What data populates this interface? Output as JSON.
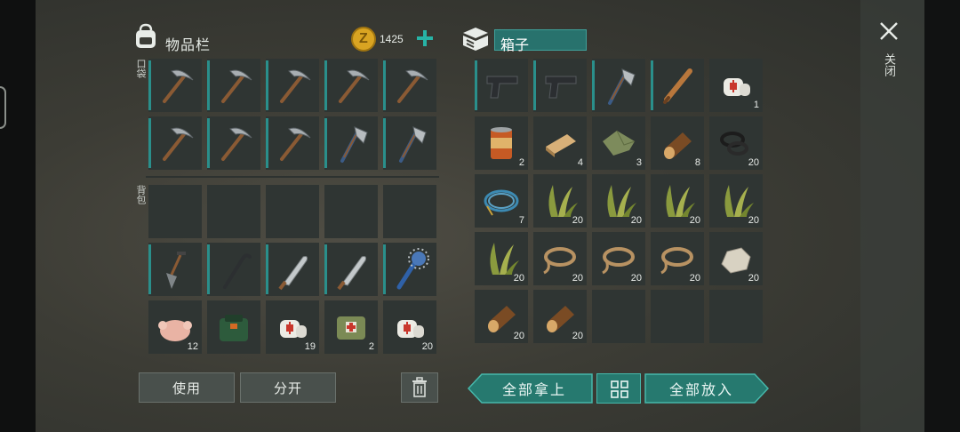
{
  "inventory": {
    "title": "物品栏",
    "coins": "1425",
    "pocket_label": "口袋",
    "backpack_label": "背包",
    "pocket_items": [
      {
        "name": "pickaxe",
        "qty": ""
      },
      {
        "name": "pickaxe",
        "qty": ""
      },
      {
        "name": "pickaxe",
        "qty": ""
      },
      {
        "name": "pickaxe",
        "qty": ""
      },
      {
        "name": "pickaxe",
        "qty": ""
      },
      {
        "name": "pickaxe",
        "qty": ""
      },
      {
        "name": "pickaxe",
        "qty": ""
      },
      {
        "name": "pickaxe",
        "qty": ""
      },
      {
        "name": "hatchet",
        "qty": ""
      },
      {
        "name": "hatchet",
        "qty": ""
      }
    ],
    "backpack_items": [
      {
        "name": "empty",
        "qty": ""
      },
      {
        "name": "empty",
        "qty": ""
      },
      {
        "name": "empty",
        "qty": ""
      },
      {
        "name": "empty",
        "qty": ""
      },
      {
        "name": "empty",
        "qty": ""
      },
      {
        "name": "shovel",
        "qty": ""
      },
      {
        "name": "crowbar",
        "qty": ""
      },
      {
        "name": "machete",
        "qty": ""
      },
      {
        "name": "machete",
        "qty": ""
      },
      {
        "name": "spiked-club",
        "qty": ""
      },
      {
        "name": "chicken",
        "qty": "12"
      },
      {
        "name": "backpack-bag",
        "qty": ""
      },
      {
        "name": "bandage",
        "qty": "19"
      },
      {
        "name": "first-aid-kit",
        "qty": "2"
      },
      {
        "name": "bandage",
        "qty": "20"
      }
    ],
    "use_button": "使用",
    "split_button": "分开"
  },
  "box": {
    "title": "箱子",
    "items": [
      {
        "name": "pistol",
        "qty": ""
      },
      {
        "name": "pistol",
        "qty": ""
      },
      {
        "name": "hatchet",
        "qty": ""
      },
      {
        "name": "baseball-bat",
        "qty": ""
      },
      {
        "name": "bandage",
        "qty": "1"
      },
      {
        "name": "canned-food",
        "qty": "2"
      },
      {
        "name": "plank",
        "qty": "4"
      },
      {
        "name": "cloth",
        "qty": "3"
      },
      {
        "name": "log",
        "qty": "8"
      },
      {
        "name": "rubber-parts",
        "qty": "20"
      },
      {
        "name": "wire",
        "qty": "7"
      },
      {
        "name": "plant-fiber",
        "qty": "20"
      },
      {
        "name": "plant-fiber",
        "qty": "20"
      },
      {
        "name": "plant-fiber",
        "qty": "20"
      },
      {
        "name": "plant-fiber",
        "qty": "20"
      },
      {
        "name": "plant-fiber",
        "qty": "20"
      },
      {
        "name": "rope",
        "qty": "20"
      },
      {
        "name": "rope",
        "qty": "20"
      },
      {
        "name": "rope",
        "qty": "20"
      },
      {
        "name": "stone",
        "qty": "20"
      },
      {
        "name": "log",
        "qty": "20"
      },
      {
        "name": "log",
        "qty": "20"
      },
      {
        "name": "empty",
        "qty": ""
      },
      {
        "name": "empty",
        "qty": ""
      },
      {
        "name": "empty",
        "qty": ""
      }
    ],
    "take_all_button": "全部拿上",
    "put_all_button": "全部放入"
  },
  "close_label": "关闭",
  "colors": {
    "teal": "#2a8f8b",
    "cell": "#2f3533",
    "coin": "#d9a422"
  }
}
